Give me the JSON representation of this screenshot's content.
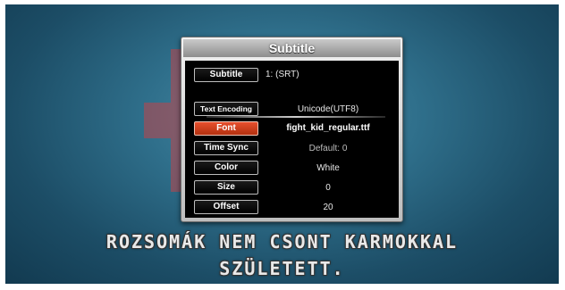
{
  "dialog": {
    "title": "Subtitle",
    "subtitle_button": "Subtitle",
    "subtitle_value": "1: (SRT)",
    "settings": [
      {
        "label": "Text Encoding",
        "value": "Unicode(UTF8)",
        "active": false
      },
      {
        "label": "Font",
        "value": "fight_kid_regular.ttf",
        "active": true
      },
      {
        "label": "Time Sync",
        "value": "Default: 0",
        "active": false
      },
      {
        "label": "Color",
        "value": "White",
        "active": false
      },
      {
        "label": "Size",
        "value": "0",
        "active": false
      },
      {
        "label": "Offset",
        "value": "20",
        "active": false
      }
    ],
    "active_color": "#d9431f"
  },
  "subtitle_text": {
    "line1": "ROZSOMÁK NEM CSONT KARMOKKAL",
    "line2": "SZÜLETETT."
  }
}
